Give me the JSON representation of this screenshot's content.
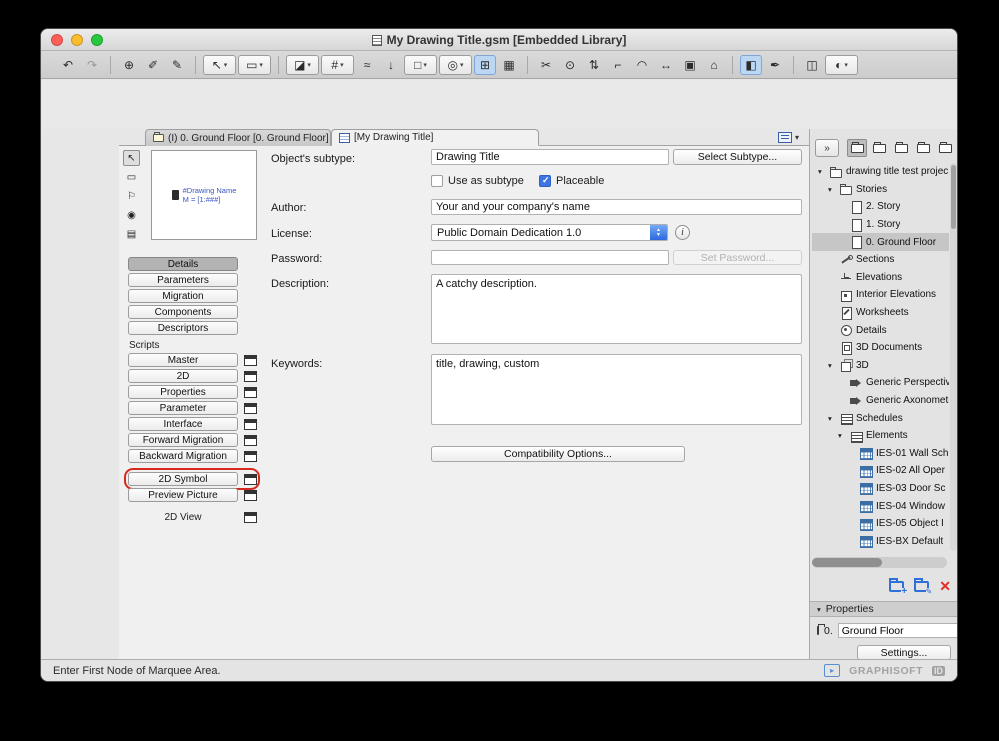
{
  "window": {
    "title": "My Drawing Title.gsm [Embedded Library]"
  },
  "icons": {
    "organizer": "»",
    "info": "i",
    "delete_x": "✕",
    "caret": "▾",
    "id_arrow": "▸"
  },
  "toolbar": {
    "items": [
      {
        "name": "undo-icon",
        "glyph": "↶"
      },
      {
        "name": "redo-icon",
        "glyph": "↷",
        "dim": true
      },
      {
        "sep": true
      },
      {
        "name": "drag-zoom-icon",
        "glyph": "⊕"
      },
      {
        "name": "pick-up-parameters-icon",
        "glyph": "✐"
      },
      {
        "name": "inject-parameters-icon",
        "glyph": "✎"
      },
      {
        "sep": true
      },
      {
        "name": "arrow-tool-icon",
        "glyph": "↖",
        "caret": true,
        "boxed": true
      },
      {
        "name": "marquee-tool-icon",
        "glyph": "▭",
        "caret": true,
        "boxed": true
      },
      {
        "sep": true
      },
      {
        "name": "wall-tool-icon",
        "glyph": "◪",
        "caret": true,
        "boxed": true
      },
      {
        "name": "grid-tool-icon",
        "glyph": "#",
        "caret": true,
        "boxed": true
      },
      {
        "name": "hatch-icon",
        "glyph": "≈"
      },
      {
        "name": "arrow-down-icon",
        "glyph": "↓"
      },
      {
        "name": "object-tool-icon",
        "glyph": "□",
        "caret": true,
        "boxed": true
      },
      {
        "name": "pin-tool-icon",
        "glyph": "◎",
        "caret": true,
        "boxed": true
      },
      {
        "name": "rotated-grid-icon",
        "glyph": "⊞",
        "active": true
      },
      {
        "name": "snap-grid-icon",
        "glyph": "▦"
      },
      {
        "sep": true
      },
      {
        "name": "trim-icon",
        "glyph": "✂"
      },
      {
        "name": "zoom-icon",
        "glyph": "⊙"
      },
      {
        "name": "adjust-icon",
        "glyph": "⇅"
      },
      {
        "name": "intersect-icon",
        "glyph": "⌐"
      },
      {
        "name": "fillet-icon",
        "glyph": "◠"
      },
      {
        "name": "resize-icon",
        "glyph": "↔"
      },
      {
        "name": "align-icon",
        "glyph": "▣"
      },
      {
        "name": "elevation-icon",
        "glyph": "⌂"
      },
      {
        "sep": true
      },
      {
        "name": "group-icon",
        "glyph": "◧",
        "active": true
      },
      {
        "name": "suspend-groups-icon",
        "glyph": "✒"
      },
      {
        "sep": true
      },
      {
        "name": "library-icon",
        "glyph": "◫"
      },
      {
        "name": "render-settings-icon",
        "glyph": "◐",
        "caret": true,
        "boxed": true
      }
    ]
  },
  "tabbar": {
    "tabs": [
      {
        "label": "(I) 0. Ground Floor [0. Ground Floor]",
        "icon": "folder"
      },
      {
        "label": "[My Drawing Title]",
        "icon": "drawing",
        "active": true
      }
    ]
  },
  "left_panel": {
    "mode_icons": [
      {
        "name": "select-mode-icon",
        "glyph": "↖",
        "selected": true
      },
      {
        "name": "2d-fragment-icon",
        "glyph": "▭"
      },
      {
        "name": "flag-icon",
        "glyph": "⚐"
      },
      {
        "name": "3d-preview-icon",
        "glyph": "◉"
      },
      {
        "name": "list-view-icon",
        "glyph": "▤"
      }
    ],
    "preview": {
      "name_line": "#Drawing Name",
      "scale_line": "M = [1:###]"
    },
    "sections": [
      {
        "label": "Details",
        "selected": true
      },
      {
        "label": "Parameters"
      },
      {
        "label": "Migration"
      },
      {
        "label": "Components"
      },
      {
        "label": "Descriptors"
      }
    ],
    "scripts_label": "Scripts",
    "scripts": [
      {
        "label": "Master"
      },
      {
        "label": "2D"
      },
      {
        "label": "Properties"
      },
      {
        "label": "Parameter"
      },
      {
        "label": "Interface"
      },
      {
        "label": "Forward Migration"
      },
      {
        "label": "Backward Migration"
      },
      {
        "label": "2D Symbol",
        "highlighted": true,
        "gap": true
      },
      {
        "label": "Preview Picture"
      }
    ],
    "view_row": {
      "label": "2D View"
    }
  },
  "form": {
    "subtype_label": "Object's subtype:",
    "subtype_value": "Drawing Title",
    "select_subtype_button": "Select Subtype...",
    "use_as_subtype_label": "Use as subtype",
    "use_as_subtype_checked": false,
    "placeable_label": "Placeable",
    "placeable_checked": true,
    "author_label": "Author:",
    "author_value": "Your and your company's name",
    "license_label": "License:",
    "license_value": "Public Domain Dedication 1.0",
    "password_label": "Password:",
    "password_value": "",
    "set_password_button": "Set Password...",
    "description_label": "Description:",
    "description_value": "A catchy description.",
    "keywords_label": "Keywords:",
    "keywords_value": "title, drawing, custom",
    "compatibility_button": "Compatibility Options..."
  },
  "navigator": {
    "header_icons": [
      {
        "name": "project-map-icon",
        "selected": true
      },
      {
        "name": "view-map-icon"
      },
      {
        "name": "layout-book-icon"
      },
      {
        "name": "publisher-icon"
      },
      {
        "name": "library-view-icon"
      }
    ],
    "items": [
      {
        "label": "drawing title test projec",
        "icon": "folder",
        "indent": 0,
        "open": true
      },
      {
        "label": "Stories",
        "icon": "folder",
        "indent": 1,
        "open": true
      },
      {
        "label": "2. Story",
        "icon": "page",
        "indent": 2
      },
      {
        "label": "1. Story",
        "icon": "page",
        "indent": 2
      },
      {
        "label": "0. Ground Floor",
        "icon": "page",
        "indent": 2,
        "selected": true
      },
      {
        "label": "Sections",
        "icon": "section",
        "indent": 1
      },
      {
        "label": "Elevations",
        "icon": "elevation",
        "indent": 1
      },
      {
        "label": "Interior Elevations",
        "icon": "interior",
        "indent": 1
      },
      {
        "label": "Worksheets",
        "icon": "worksheet",
        "indent": 1
      },
      {
        "label": "Details",
        "icon": "detail",
        "indent": 1
      },
      {
        "label": "3D Documents",
        "icon": "doc3d",
        "indent": 1
      },
      {
        "label": "3D",
        "icon": "cube",
        "indent": 1,
        "open": true
      },
      {
        "label": "Generic Perspective",
        "icon": "camera",
        "indent": 2
      },
      {
        "label": "Generic Axonometry",
        "icon": "camera",
        "indent": 2
      },
      {
        "label": "Schedules",
        "icon": "list",
        "indent": 1,
        "open": true
      },
      {
        "label": "Elements",
        "icon": "list",
        "indent": 2,
        "open": true
      },
      {
        "label": "IES-01 Wall Sch",
        "icon": "table",
        "indent": 3
      },
      {
        "label": "IES-02 All Oper",
        "icon": "table",
        "indent": 3
      },
      {
        "label": "IES-03 Door Sc",
        "icon": "table",
        "indent": 3
      },
      {
        "label": "IES-04 Window",
        "icon": "table",
        "indent": 3
      },
      {
        "label": "IES-05 Object I",
        "icon": "table",
        "indent": 3
      },
      {
        "label": "IES-BX Default",
        "icon": "table",
        "indent": 3
      }
    ],
    "properties_header": "Properties",
    "story_prefix": "0.",
    "story_name": "Ground Floor",
    "settings_button": "Settings..."
  },
  "status_bar": {
    "message": "Enter First Node of Marquee Area.",
    "brand": "GRAPHISOFT",
    "brand_badge": "ID"
  }
}
